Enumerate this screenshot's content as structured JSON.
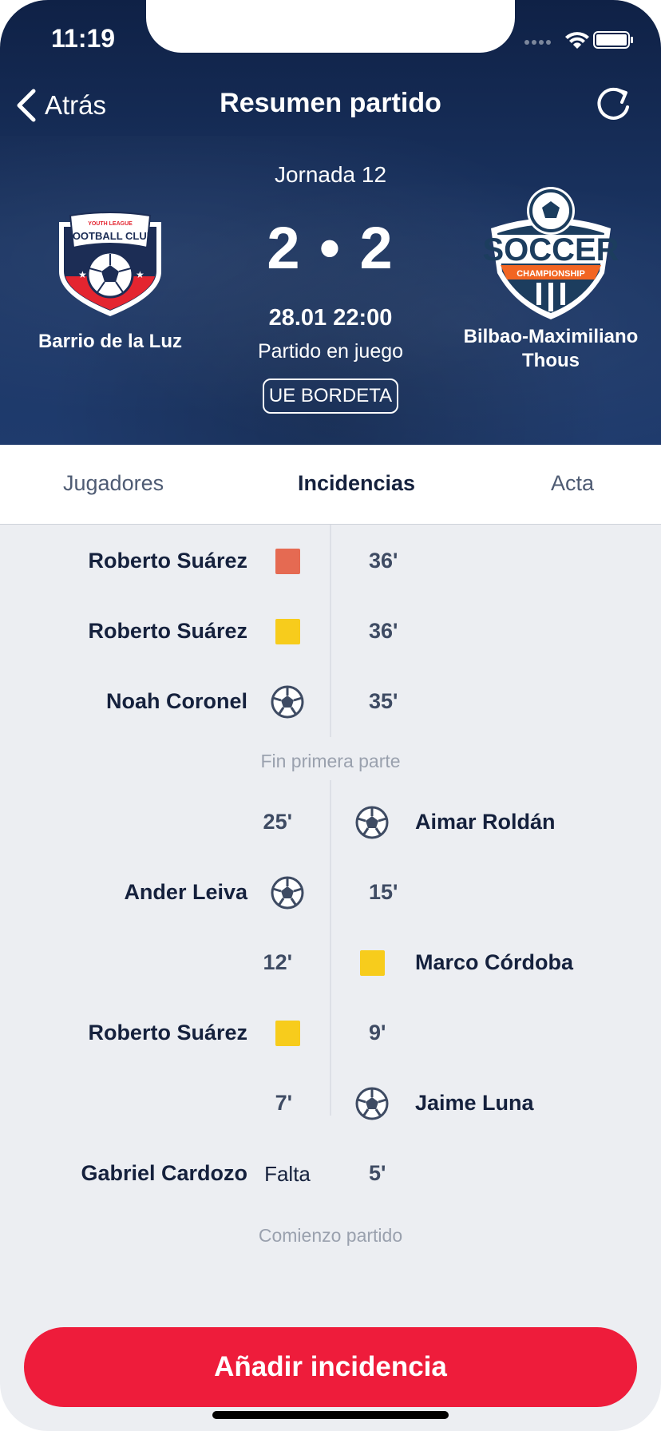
{
  "status": {
    "time": "11:19"
  },
  "nav": {
    "back_label": "Atrás",
    "title": "Resumen partido"
  },
  "match": {
    "round": "Jornada 12",
    "score": "2 • 2",
    "datetime": "28.01 22:00",
    "state": "Partido en juego",
    "venue": "UE BORDETA",
    "home_team": "Barrio de la Luz",
    "away_team": "Bilbao-Maximiliano Thous",
    "home_badge_text": {
      "top": "YOUTH LEAGUE",
      "main": "FOOTBALL CLUB"
    },
    "away_badge_text": {
      "main": "SOCCER",
      "ribbon": "CHAMPIONSHIP"
    }
  },
  "tabs": [
    {
      "label": "Jugadores"
    },
    {
      "label": "Incidencias",
      "active": true
    },
    {
      "label": "Acta"
    }
  ],
  "events_second_half": [
    {
      "side": "left",
      "player": "Roberto Suárez",
      "icon": "red-card",
      "time": "36'"
    },
    {
      "side": "left",
      "player": "Roberto Suárez",
      "icon": "yellow-card",
      "time": "36'"
    },
    {
      "side": "left",
      "player": "Noah Coronel",
      "icon": "ball",
      "time": "35'"
    }
  ],
  "separator_half": "Fin primera parte",
  "events_first_half": [
    {
      "side": "right",
      "player": "Aimar Roldán",
      "icon": "ball",
      "time": "25'"
    },
    {
      "side": "left",
      "player": "Ander Leiva",
      "icon": "ball",
      "time": "15'"
    },
    {
      "side": "right",
      "player": "Marco Córdoba",
      "icon": "yellow-card",
      "time": "12'"
    },
    {
      "side": "left",
      "player": "Roberto Suárez",
      "icon": "yellow-card",
      "time": "9'"
    },
    {
      "side": "right",
      "player": "Jaime Luna",
      "icon": "ball",
      "time": "7'"
    },
    {
      "side": "left",
      "player": "Gabriel Cardozo",
      "icon": "text",
      "icon_text": "Falta",
      "time": "5'"
    }
  ],
  "separator_start": "Comienzo partido",
  "cta_label": "Añadir incidencia",
  "colors": {
    "accent": "#ee1c3b",
    "red_card": "#e56a52",
    "yellow_card": "#f7cc1c",
    "header": "#1b3563"
  }
}
